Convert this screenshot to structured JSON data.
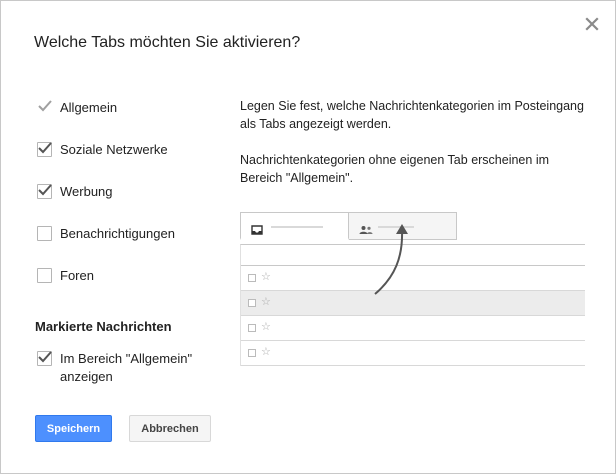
{
  "dialog": {
    "title": "Welche Tabs möchten Sie aktivieren?",
    "close_icon": "close-icon"
  },
  "tabs": [
    {
      "label": "Allgemein",
      "checked": true,
      "disabled": true
    },
    {
      "label": "Soziale Netzwerke",
      "checked": true,
      "disabled": false
    },
    {
      "label": "Werbung",
      "checked": true,
      "disabled": false
    },
    {
      "label": "Benachrichtigungen",
      "checked": false,
      "disabled": false
    },
    {
      "label": "Foren",
      "checked": false,
      "disabled": false
    }
  ],
  "starred_section": {
    "heading": "Markierte Nachrichten",
    "option_label": "Im Bereich \"Allgemein\" anzeigen",
    "option_checked": true
  },
  "description": {
    "paragraph1": "Legen Sie fest, welche Nachrichtenkategorien im Posteingang als Tabs angezeigt werden.",
    "paragraph2": "Nachrichtenkategorien ohne eigenen Tab erscheinen im Bereich \"Allgemein\"."
  },
  "illustration": {
    "tab_icons": [
      "inbox-icon",
      "people-icon"
    ],
    "row_icons": [
      "checkbox-icon",
      "star-icon"
    ],
    "row_count": 5,
    "highlighted_row": 2
  },
  "buttons": {
    "save": "Speichern",
    "cancel": "Abbrechen"
  },
  "colors": {
    "primary_button": "#4d90fe",
    "primary_button_border": "#3079ed",
    "checkmark": "#555555"
  }
}
